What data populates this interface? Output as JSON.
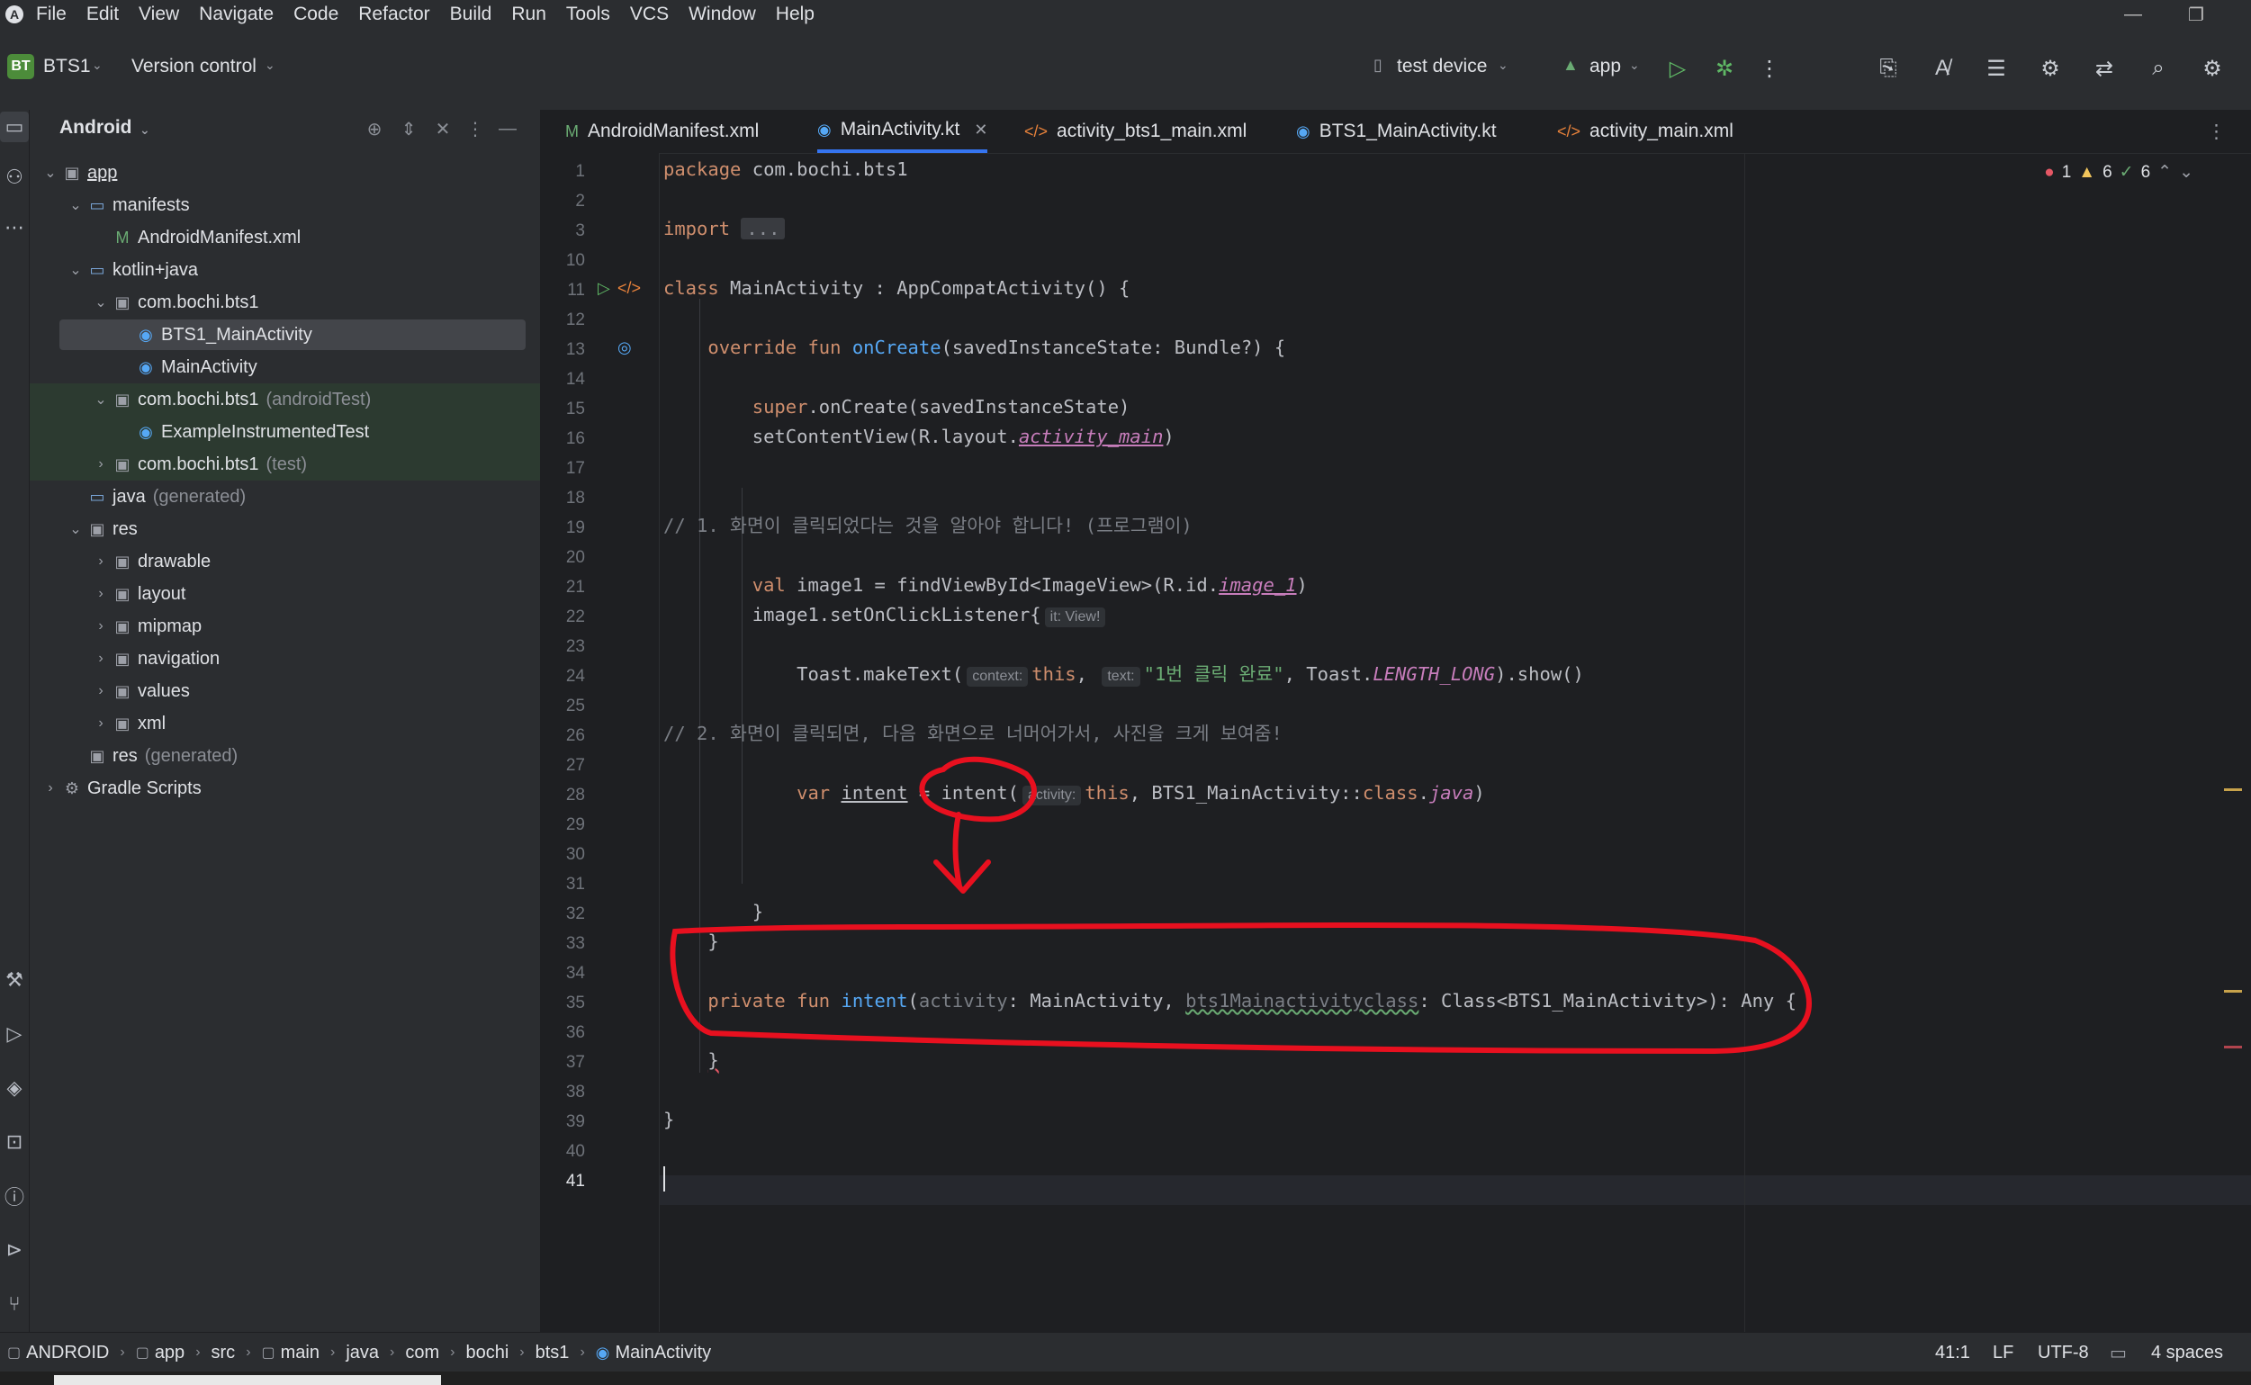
{
  "menu": [
    "File",
    "Edit",
    "View",
    "Navigate",
    "Code",
    "Refactor",
    "Build",
    "Run",
    "Tools",
    "VCS",
    "Window",
    "Help"
  ],
  "toolbar": {
    "project_badge": "BT",
    "project_name": "BTS1",
    "vcs_label": "Version control",
    "device": "test device",
    "run_config": "app"
  },
  "project_panel": {
    "view_label": "Android",
    "tree": [
      {
        "label": "app",
        "suffix": ""
      },
      {
        "label": "manifests",
        "suffix": ""
      },
      {
        "label": "AndroidManifest.xml",
        "suffix": ""
      },
      {
        "label": "kotlin+java",
        "suffix": ""
      },
      {
        "label": "com.bochi.bts1",
        "suffix": ""
      },
      {
        "label": "BTS1_MainActivity",
        "suffix": ""
      },
      {
        "label": "MainActivity",
        "suffix": ""
      },
      {
        "label": "com.bochi.bts1",
        "suffix": "(androidTest)"
      },
      {
        "label": "ExampleInstrumentedTest",
        "suffix": ""
      },
      {
        "label": "com.bochi.bts1",
        "suffix": "(test)"
      },
      {
        "label": "java",
        "suffix": "(generated)"
      },
      {
        "label": "res",
        "suffix": ""
      },
      {
        "label": "drawable",
        "suffix": ""
      },
      {
        "label": "layout",
        "suffix": ""
      },
      {
        "label": "mipmap",
        "suffix": ""
      },
      {
        "label": "navigation",
        "suffix": ""
      },
      {
        "label": "values",
        "suffix": ""
      },
      {
        "label": "xml",
        "suffix": ""
      },
      {
        "label": "res",
        "suffix": "(generated)"
      },
      {
        "label": "Gradle Scripts",
        "suffix": ""
      }
    ]
  },
  "tabs": [
    {
      "label": "AndroidManifest.xml"
    },
    {
      "label": "MainActivity.kt"
    },
    {
      "label": "activity_bts1_main.xml"
    },
    {
      "label": "BTS1_MainActivity.kt"
    },
    {
      "label": "activity_main.xml"
    }
  ],
  "inspections": {
    "errors": "1",
    "warnings": "6",
    "weak": "6"
  },
  "code": {
    "l1": [
      "package",
      " com.bochi.bts1"
    ],
    "l3_import": "import",
    "l3_fold": "...",
    "l11": [
      "class",
      " MainActivity : AppCompatActivity() {"
    ],
    "l13": [
      "override fun",
      "onCreate",
      "(savedInstanceState: Bundle?) {"
    ],
    "l15": [
      "super",
      ".onCreate(savedInstanceState)"
    ],
    "l16": [
      "setContentView(R.layout.",
      "activity_main",
      ")"
    ],
    "l19": "// 1. 화면이 클릭되었다는 것을 알아야 합니다! (프로그램이)",
    "l21": [
      "val",
      " image1 = findViewById<ImageView>(R.id.",
      "image_1",
      ")"
    ],
    "l22": [
      "image1.setOnClickListener{",
      "it: View!"
    ],
    "l24": [
      "Toast.makeText(",
      "context:",
      "this",
      ",",
      "text:",
      "\"1번 클릭 완료\"",
      ", Toast.",
      "LENGTH_LONG",
      ").show()"
    ],
    "l26": "// 2. 화면이 클릭되면, 다음 화면으로 너머어가서, 사진을 크게 보여줌!",
    "l28": [
      "var",
      "intent",
      " = intent(",
      "activity:",
      "this",
      ", BTS1_MainActivity::",
      "class",
      ".",
      "java",
      ")"
    ],
    "l32": "}",
    "l33": "}",
    "l35": [
      "private fun",
      "intent",
      "(",
      "activity",
      ": MainActivity, ",
      "bts1Mainactivityclass",
      ": Class<BTS1_MainActivity>): Any {"
    ],
    "l37": "}",
    "l39": "}"
  },
  "status": {
    "breadcrumbs": [
      "ANDROID",
      "app",
      "src",
      "main",
      "java",
      "com",
      "bochi",
      "bts1",
      "MainActivity"
    ],
    "position": "41:1",
    "line_sep": "LF",
    "encoding": "UTF-8",
    "indent": "4 spaces"
  },
  "colors": {
    "keyword": "#cf8e6d",
    "function": "#56a8f5",
    "string": "#6aab73",
    "comment": "#7a7e85",
    "annotation": "#e8101f",
    "accent": "#3574f0"
  }
}
